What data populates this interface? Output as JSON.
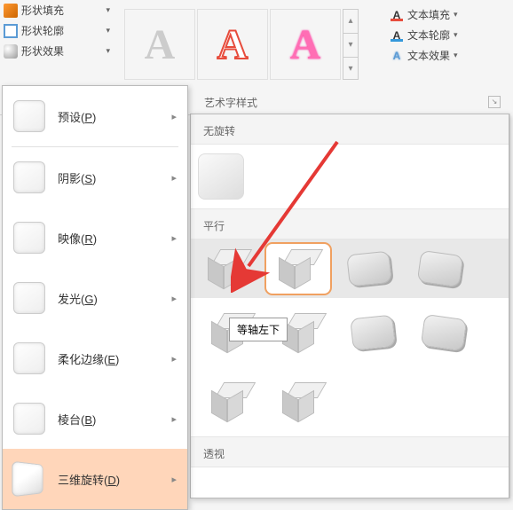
{
  "ribbon": {
    "shape_fill": "形状填充",
    "shape_outline": "形状轮廓",
    "shape_effects": "形状效果",
    "text_fill": "文本填充",
    "text_outline": "文本轮廓",
    "text_effects": "文本效果",
    "wordart_group": "艺术字样式",
    "wordart_glyph": "A"
  },
  "effects_menu": {
    "preset": {
      "label_pre": "预设(",
      "key": "P",
      "label_post": ")"
    },
    "shadow": {
      "label_pre": "阴影(",
      "key": "S",
      "label_post": ")"
    },
    "reflection": {
      "label_pre": "映像(",
      "key": "R",
      "label_post": ")"
    },
    "glow": {
      "label_pre": "发光(",
      "key": "G",
      "label_post": ")"
    },
    "soft_edges": {
      "label_pre": "柔化边缘(",
      "key": "E",
      "label_post": ")"
    },
    "bevel": {
      "label_pre": "棱台(",
      "key": "B",
      "label_post": ")"
    },
    "rotation3d": {
      "label_pre": "三维旋转(",
      "key": "D",
      "label_post": ")"
    }
  },
  "submenu": {
    "no_rotation": "无旋转",
    "parallel": "平行",
    "perspective": "透视"
  },
  "tooltip": "等轴左下"
}
